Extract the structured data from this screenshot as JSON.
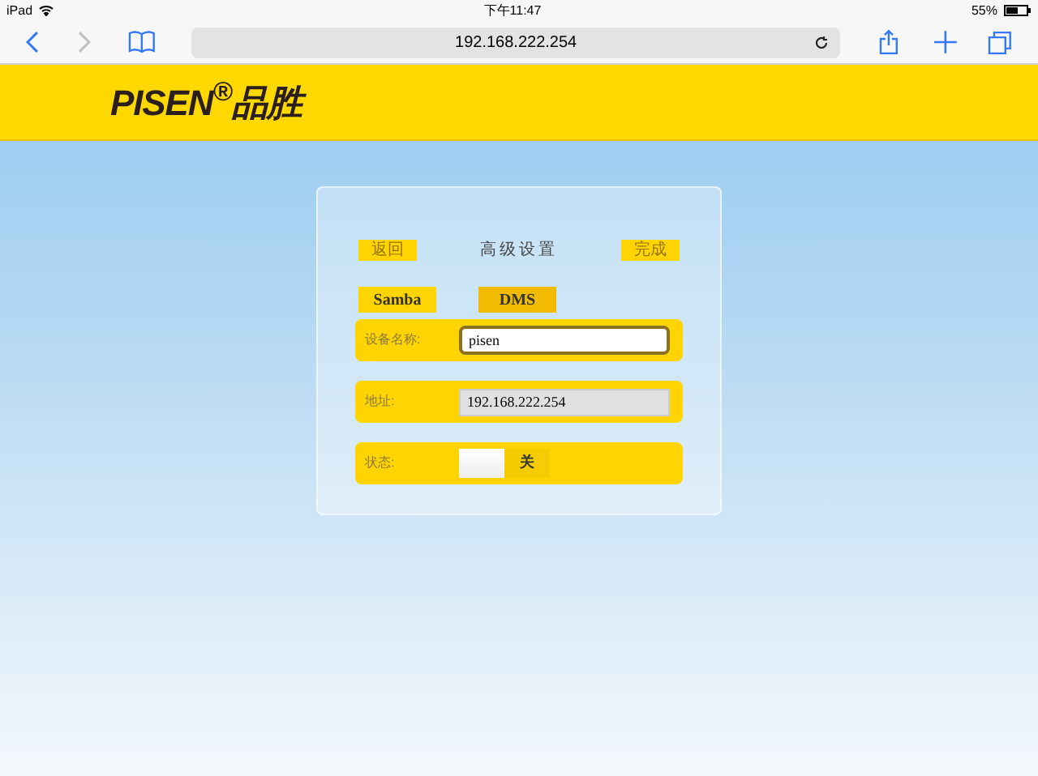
{
  "status_bar": {
    "device": "iPad",
    "time": "下午11:47",
    "battery": "55%"
  },
  "browser": {
    "url": "192.168.222.254"
  },
  "header": {
    "logo": "PISEN",
    "logo_cn": "品胜",
    "registered": "®"
  },
  "panel": {
    "back": "返回",
    "title": "高级设置",
    "done": "完成",
    "tabs": [
      {
        "label": "Samba",
        "selected": false
      },
      {
        "label": "DMS",
        "selected": true
      }
    ],
    "fields": [
      {
        "kind": "input",
        "label": "设备名称:",
        "value": "pisen",
        "disabled": false
      },
      {
        "kind": "input",
        "label": "地址:",
        "value": "192.168.222.254",
        "disabled": true
      },
      {
        "kind": "toggle",
        "label": "状态:",
        "value": "关",
        "on": false
      }
    ]
  }
}
